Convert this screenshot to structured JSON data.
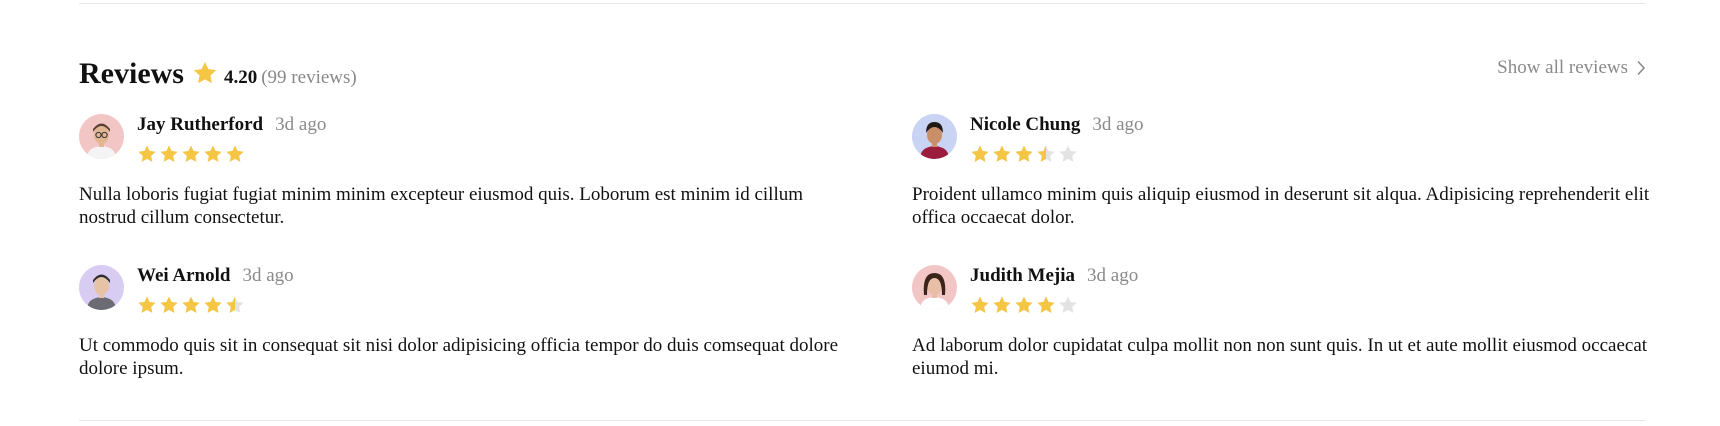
{
  "header": {
    "title": "Reviews",
    "rating": "4.20",
    "count": "(99 reviews)",
    "show_all_label": "Show all reviews"
  },
  "colors": {
    "star_fill": "#F5C544",
    "star_empty": "#E3E3E3",
    "muted_text": "#8A8A8A"
  },
  "reviews": [
    {
      "name": "Jay Rutherford",
      "time": "3d ago",
      "rating": 5,
      "text": "Nulla loboris fugiat fugiat minim minim excepteur eiusmod quis. Loborum est minim id cillum nostrud cillum consectetur.",
      "avatar_bg": "#F3C6C6"
    },
    {
      "name": "Nicole Chung",
      "time": "3d ago",
      "rating": 3.5,
      "text": "Proident ullamco minim quis aliquip eiusmod in deserunt sit alqua. Adipisicing reprehenderit elit offica occaecat dolor.",
      "avatar_bg": "#C9D3F3"
    },
    {
      "name": "Wei Arnold",
      "time": "3d ago",
      "rating": 4.5,
      "text": "Ut commodo quis sit in consequat sit nisi dolor adipisicing officia tempor do duis comsequat dolore dolore ipsum.",
      "avatar_bg": "#D8CCF3"
    },
    {
      "name": "Judith Mejia",
      "time": "3d ago",
      "rating": 4,
      "text": "Ad laborum dolor cupidatat culpa mollit non non sunt quis. In ut et aute mollit eiusmod occaecat eiumod mi.",
      "avatar_bg": "#F3C6C6"
    }
  ]
}
